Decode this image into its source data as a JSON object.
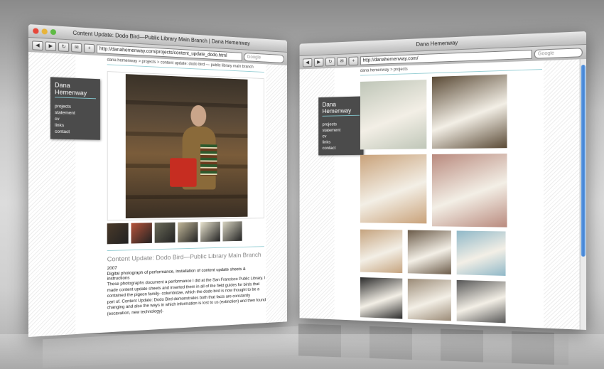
{
  "left_window": {
    "title": "Content Update: Dodo Bird—Public Library Main Branch | Dana Hemenway",
    "url": "http://danahemenway.com/projects/content_update_dodo.html",
    "search_placeholder": "Google",
    "breadcrumb": "dana hemenway > projects > content update: dodo bird — public library main branch",
    "site_name": "Dana Hemenway",
    "nav": [
      "projects",
      "statement",
      "cv",
      "links",
      "contact"
    ],
    "project_title": "Content Update: Dodo Bird—Public Library Main Branch",
    "year": "2007",
    "subtitle": "Digital photograph of performance, installation of content update sheets & instructions",
    "description": "These photographs document a performance I did at the San Francisco Public Library. I made content update sheets and inserted them in all of the field guides for birds that contained the pigeon family- columbidae, which the dodo bird is now thought to be a part of. Content Update: Dodo Bird demonstrates both that facts are constantly changing and also the ways in which information is lost to us (extinction) and then found (excavation, new technology).",
    "thumb_colors": [
      "#4a3a2a",
      "#b5533a",
      "#6b6b5a",
      "#c2b89a",
      "#e9e4cf",
      "#d9d5c2"
    ]
  },
  "right_window": {
    "title": "Dana Hemenway",
    "url": "http://danahemenway.com/",
    "search_placeholder": "Google",
    "breadcrumb": "dana hemenway > projects",
    "site_name": "Dana Hemenway",
    "nav": [
      "projects",
      "statement",
      "cv",
      "links",
      "contact"
    ],
    "grid_colors": [
      "#bfc6b8",
      "#5a4a36",
      "#c9a27a",
      "#b98a7e",
      "#c5a37e",
      "#6a5a48",
      "#8fb8c8",
      "#2a2a2a",
      "#9a8a76",
      "#555555"
    ]
  },
  "colors": {
    "accent": "#9ad0d6",
    "nav_bg": "#4b4b4b",
    "title_gray": "#888888"
  }
}
